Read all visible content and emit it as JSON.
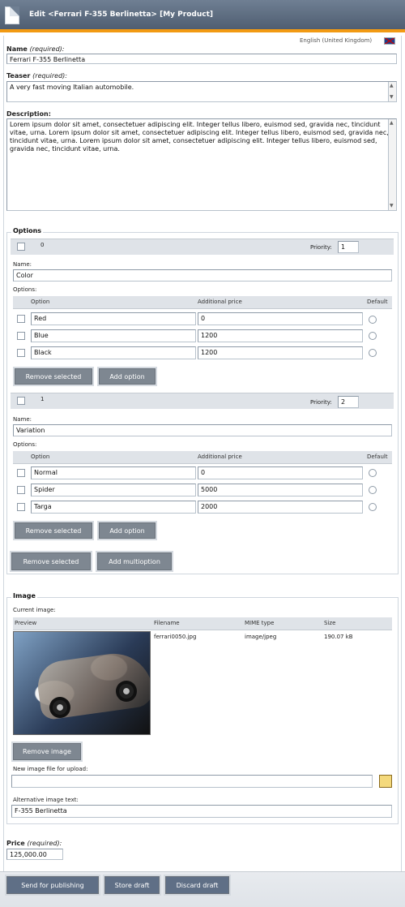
{
  "header": {
    "title": "Edit <Ferrari F-355 Berlinetta> [My Product]"
  },
  "language": {
    "label": "English (United Kingdom)"
  },
  "form": {
    "name": {
      "label": "Name",
      "required": "(required):",
      "value": "Ferrari F-355 Berlinetta"
    },
    "teaser": {
      "label": "Teaser",
      "required": "(required):",
      "value": "A very fast moving Italian automobile."
    },
    "description": {
      "label": "Description:",
      "value": "Lorem ipsum dolor sit amet, consectetuer adipiscing elit. Integer tellus libero, euismod sed, gravida nec, tincidunt vitae, urna. Lorem ipsum dolor sit amet, consectetuer adipiscing elit. Integer tellus libero, euismod sed, gravida nec, tincidunt vitae, urna. Lorem ipsum dolor sit amet, consectetuer adipiscing elit. Integer tellus libero, euismod sed, gravida nec, tincidunt vitae, urna."
    },
    "options_section": {
      "legend": "Options",
      "priority_label": "Priority:",
      "name_label": "Name:",
      "options_label": "Options:",
      "col_option": "Option",
      "col_additional_price": "Additional price",
      "col_default": "Default",
      "remove_selected": "Remove selected",
      "add_option": "Add option",
      "remove_selected_outer": "Remove selected",
      "add_multioption": "Add multioption",
      "groups": [
        {
          "index": "0",
          "priority": "1",
          "name": "Color",
          "rows": [
            {
              "option": "Red",
              "price": "0"
            },
            {
              "option": "Blue",
              "price": "1200"
            },
            {
              "option": "Black",
              "price": "1200"
            }
          ]
        },
        {
          "index": "1",
          "priority": "2",
          "name": "Variation",
          "rows": [
            {
              "option": "Normal",
              "price": "0"
            },
            {
              "option": "Spider",
              "price": "5000"
            },
            {
              "option": "Targa",
              "price": "2000"
            }
          ]
        }
      ]
    },
    "image_section": {
      "legend": "Image",
      "current_image_label": "Current image:",
      "table": {
        "preview": "Preview",
        "filename": "Filename",
        "mime": "MIME type",
        "size": "Size",
        "filename_value": "ferrari0050.jpg",
        "mime_value": "image/jpeg",
        "size_value": "190.07 kB"
      },
      "remove_image": "Remove image",
      "upload_label": "New image file for upload:",
      "alt_label": "Alternative image text:",
      "alt_value": "F-355 Berlinetta"
    },
    "price": {
      "label": "Price",
      "required": "(required):",
      "value": "125,000.00"
    }
  },
  "footer": {
    "send_for_publishing": "Send for publishing",
    "store_draft": "Store draft",
    "discard_draft": "Discard draft"
  },
  "icons": {
    "document": "document-icon",
    "flag": "flag-icon",
    "folder": "folder-icon"
  }
}
